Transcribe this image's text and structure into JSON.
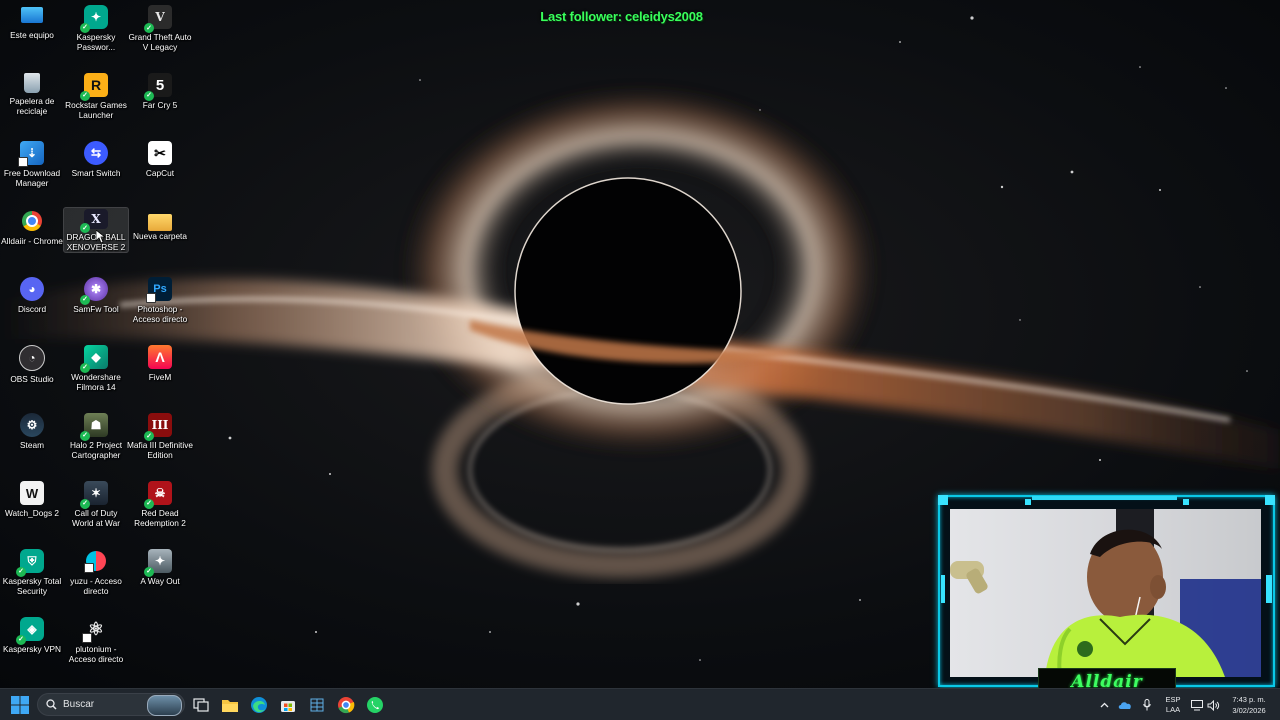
{
  "stream_overlay": {
    "follower_label": "Last follower:",
    "follower_name": "celeidys2008",
    "streamer_name": "Alldair",
    "frame_color": "#0ac8e6",
    "text_color": "#39ff5c"
  },
  "desktop": {
    "icons": [
      {
        "label": "Este equipo",
        "icon": "computer-icon"
      },
      {
        "label": "Kaspersky Passwor...",
        "icon": "kaspersky-password-icon"
      },
      {
        "label": "Grand Theft Auto V Legacy",
        "icon": "gta-icon"
      },
      {
        "label": "Papelera de reciclaje",
        "icon": "recycle-bin-icon"
      },
      {
        "label": "Rockstar Games Launcher",
        "icon": "rockstar-icon"
      },
      {
        "label": "Far Cry 5",
        "icon": "farcry-icon"
      },
      {
        "label": "Free Download Manager",
        "icon": "download-manager-icon"
      },
      {
        "label": "Smart Switch",
        "icon": "smart-switch-icon"
      },
      {
        "label": "CapCut",
        "icon": "capcut-icon"
      },
      {
        "label": "Alldaiir - Chrome",
        "icon": "chrome-icon"
      },
      {
        "label": "DRAGON BALL XENOVERSE 2",
        "icon": "dragonball-icon"
      },
      {
        "label": "Nueva carpeta",
        "icon": "folder-icon"
      },
      {
        "label": "Discord",
        "icon": "discord-icon"
      },
      {
        "label": "SamFw Tool",
        "icon": "samfw-icon"
      },
      {
        "label": "Photoshop - Acceso directo",
        "icon": "photoshop-icon"
      },
      {
        "label": "OBS Studio",
        "icon": "obs-icon"
      },
      {
        "label": "Wondershare Filmora 14",
        "icon": "filmora-icon"
      },
      {
        "label": "FiveM",
        "icon": "fivem-icon"
      },
      {
        "label": "Steam",
        "icon": "steam-icon"
      },
      {
        "label": "Halo 2 Project Cartographer",
        "icon": "halo-icon"
      },
      {
        "label": "Mafia III Definitive Edition",
        "icon": "mafia-icon"
      },
      {
        "label": "Watch_Dogs 2",
        "icon": "watchdogs-icon"
      },
      {
        "label": "Call of Duty World at War",
        "icon": "cod-icon"
      },
      {
        "label": "Red Dead Redemption 2",
        "icon": "rdr2-icon"
      },
      {
        "label": "Kaspersky Total Security",
        "icon": "kaspersky-security-icon"
      },
      {
        "label": "yuzu - Acceso directo",
        "icon": "yuzu-icon"
      },
      {
        "label": "A Way Out",
        "icon": "awayout-icon"
      },
      {
        "label": "Kaspersky VPN",
        "icon": "kaspersky-vpn-icon"
      },
      {
        "label": "plutonium - Acceso directo",
        "icon": "plutonium-icon"
      }
    ]
  },
  "taskbar": {
    "search_placeholder": "Buscar",
    "apps": [
      "task-view-icon",
      "file-explorer-icon",
      "edge-icon",
      "store-icon",
      "sheets-app-icon",
      "chrome-icon",
      "whatsapp-icon"
    ],
    "language_line1": "ESP",
    "language_line2": "LAA",
    "time": "7:43 p. m.",
    "date": "3/02/2026"
  }
}
